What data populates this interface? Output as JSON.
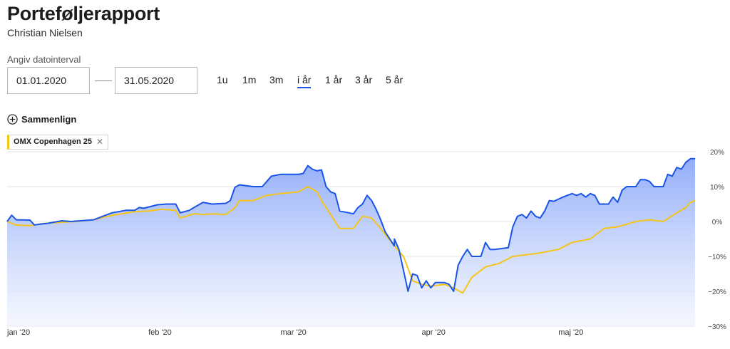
{
  "header": {
    "title": "Porteføljerapport",
    "subtitle": "Christian Nielsen"
  },
  "date_range": {
    "label": "Angiv datointerval",
    "from": "01.01.2020",
    "to": "31.05.2020"
  },
  "periods": [
    "1u",
    "1m",
    "3m",
    "i år",
    "1 år",
    "3 år",
    "5 år"
  ],
  "active_period": "i år",
  "compare": {
    "label": "Sammenlign",
    "chip_label": "OMX Copenhagen 25",
    "chip_color": "#f5c518"
  },
  "colors": {
    "portfolio": "#1a55e8",
    "benchmark": "#f5c518",
    "fill_top": "#7f9ef8",
    "fill_bottom": "#eef2fe"
  },
  "chart_data": {
    "type": "line",
    "title": "",
    "xlabel": "",
    "ylabel": "",
    "x_domain": [
      "2020-01-01",
      "2020-05-31"
    ],
    "x_ticks": [
      {
        "date": "2020-01-01",
        "label": "jan '20"
      },
      {
        "date": "2020-02-01",
        "label": "feb '20"
      },
      {
        "date": "2020-03-01",
        "label": "mar '20"
      },
      {
        "date": "2020-04-01",
        "label": "apr '20"
      },
      {
        "date": "2020-05-01",
        "label": "maj '20"
      }
    ],
    "y_ticks": [
      {
        "value": 20,
        "label": "20%"
      },
      {
        "value": 10,
        "label": "10%"
      },
      {
        "value": 0,
        "label": "0%"
      },
      {
        "value": -10,
        "label": "−10%"
      },
      {
        "value": -20,
        "label": "−20%"
      },
      {
        "value": -30,
        "label": "−30%"
      }
    ],
    "ylim": [
      -30,
      20
    ],
    "grid": true,
    "series": [
      {
        "values": [
          [
            "2020-01-01",
            0
          ],
          [
            "2020-01-02",
            1.8
          ],
          [
            "2020-01-03",
            0.5
          ],
          [
            "2020-01-06",
            0.4
          ],
          [
            "2020-01-07",
            -1.0
          ],
          [
            "2020-01-08",
            -0.8
          ],
          [
            "2020-01-10",
            -0.5
          ],
          [
            "2020-01-13",
            0.2
          ],
          [
            "2020-01-15",
            0
          ],
          [
            "2020-01-17",
            0.2
          ],
          [
            "2020-01-20",
            0.5
          ],
          [
            "2020-01-22",
            1.5
          ],
          [
            "2020-01-24",
            2.5
          ],
          [
            "2020-01-27",
            3.2
          ],
          [
            "2020-01-29",
            3.2
          ],
          [
            "2020-01-30",
            4.0
          ],
          [
            "2020-01-31",
            3.8
          ],
          [
            "2020-02-03",
            4.8
          ],
          [
            "2020-02-05",
            5.0
          ],
          [
            "2020-02-07",
            5.0
          ],
          [
            "2020-02-08",
            2.5
          ],
          [
            "2020-02-10",
            3.2
          ],
          [
            "2020-02-11",
            4.0
          ],
          [
            "2020-02-13",
            5.5
          ],
          [
            "2020-02-15",
            5.0
          ],
          [
            "2020-02-18",
            5.2
          ],
          [
            "2020-02-19",
            6.0
          ],
          [
            "2020-02-20",
            9.8
          ],
          [
            "2020-02-21",
            10.5
          ],
          [
            "2020-02-24",
            10.0
          ],
          [
            "2020-02-26",
            10.0
          ],
          [
            "2020-02-27",
            11.5
          ],
          [
            "2020-02-28",
            13.0
          ],
          [
            "2020-03-01",
            13.5
          ],
          [
            "2020-03-03",
            13.5
          ],
          [
            "2020-03-05",
            13.5
          ],
          [
            "2020-03-06",
            13.8
          ],
          [
            "2020-03-07",
            16.0
          ],
          [
            "2020-03-08",
            15.0
          ],
          [
            "2020-03-09",
            14.5
          ],
          [
            "2020-03-10",
            14.8
          ],
          [
            "2020-03-11",
            10.0
          ],
          [
            "2020-03-12",
            8.5
          ],
          [
            "2020-03-13",
            8.0
          ],
          [
            "2020-03-14",
            3.0
          ],
          [
            "2020-03-16",
            2.5
          ],
          [
            "2020-03-17",
            2.2
          ],
          [
            "2020-03-18",
            4.0
          ],
          [
            "2020-03-19",
            5.0
          ],
          [
            "2020-03-20",
            7.5
          ],
          [
            "2020-03-21",
            6.0
          ],
          [
            "2020-03-22",
            3.5
          ],
          [
            "2020-03-23",
            0.5
          ],
          [
            "2020-03-24",
            -3.0
          ],
          [
            "2020-03-25",
            -5.0
          ],
          [
            "2020-03-26",
            -7.0
          ],
          [
            "2020-03-26",
            -5.0
          ],
          [
            "2020-03-27",
            -8.0
          ],
          [
            "2020-03-29",
            -20.0
          ],
          [
            "2020-03-30",
            -15.0
          ],
          [
            "2020-03-31",
            -15.5
          ],
          [
            "2020-04-01",
            -19.0
          ],
          [
            "2020-04-02",
            -17.0
          ],
          [
            "2020-04-03",
            -19.0
          ],
          [
            "2020-04-04",
            -17.5
          ],
          [
            "2020-04-06",
            -17.5
          ],
          [
            "2020-04-07",
            -18.0
          ],
          [
            "2020-04-08",
            -20.0
          ],
          [
            "2020-04-09",
            -12.5
          ],
          [
            "2020-04-10",
            -10.0
          ],
          [
            "2020-04-11",
            -8.0
          ],
          [
            "2020-04-12",
            -10.0
          ],
          [
            "2020-04-14",
            -10.0
          ],
          [
            "2020-04-15",
            -6.0
          ],
          [
            "2020-04-16",
            -8.0
          ],
          [
            "2020-04-17",
            -8.0
          ],
          [
            "2020-04-20",
            -7.5
          ],
          [
            "2020-04-21",
            -1.5
          ],
          [
            "2020-04-22",
            1.5
          ],
          [
            "2020-04-23",
            2.0
          ],
          [
            "2020-04-24",
            1.0
          ],
          [
            "2020-04-25",
            3.0
          ],
          [
            "2020-04-26",
            1.5
          ],
          [
            "2020-04-27",
            1.0
          ],
          [
            "2020-04-28",
            3.0
          ],
          [
            "2020-04-29",
            6.0
          ],
          [
            "2020-04-30",
            5.8
          ],
          [
            "2020-05-02",
            7.0
          ],
          [
            "2020-05-04",
            8.0
          ],
          [
            "2020-05-05",
            7.5
          ],
          [
            "2020-05-06",
            8.0
          ],
          [
            "2020-05-07",
            7.0
          ],
          [
            "2020-05-08",
            8.0
          ],
          [
            "2020-05-09",
            7.5
          ],
          [
            "2020-05-10",
            5.0
          ],
          [
            "2020-05-12",
            5.0
          ],
          [
            "2020-05-13",
            7.0
          ],
          [
            "2020-05-14",
            5.5
          ],
          [
            "2020-05-15",
            9.0
          ],
          [
            "2020-05-16",
            10.0
          ],
          [
            "2020-05-18",
            10.0
          ],
          [
            "2020-05-19",
            12.0
          ],
          [
            "2020-05-20",
            12.0
          ],
          [
            "2020-05-21",
            11.5
          ],
          [
            "2020-05-22",
            10.0
          ],
          [
            "2020-05-24",
            10.0
          ],
          [
            "2020-05-25",
            13.5
          ],
          [
            "2020-05-26",
            13.0
          ],
          [
            "2020-05-27",
            15.5
          ],
          [
            "2020-05-28",
            15.0
          ],
          [
            "2020-05-29",
            17.0
          ],
          [
            "2020-05-30",
            18.0
          ],
          [
            "2020-05-31",
            18.0
          ]
        ]
      },
      {
        "name": "OMX Copenhagen 25",
        "values": [
          [
            "2020-01-01",
            0
          ],
          [
            "2020-01-03",
            -1.0
          ],
          [
            "2020-01-06",
            -1.2
          ],
          [
            "2020-01-09",
            -0.6
          ],
          [
            "2020-01-13",
            -0.2
          ],
          [
            "2020-01-16",
            0
          ],
          [
            "2020-01-20",
            0.5
          ],
          [
            "2020-01-22",
            1.2
          ],
          [
            "2020-01-25",
            2.0
          ],
          [
            "2020-01-29",
            2.8
          ],
          [
            "2020-02-01",
            3.0
          ],
          [
            "2020-02-04",
            3.5
          ],
          [
            "2020-02-07",
            3.2
          ],
          [
            "2020-02-08",
            1.0
          ],
          [
            "2020-02-11",
            2.2
          ],
          [
            "2020-02-13",
            2.0
          ],
          [
            "2020-02-15",
            2.2
          ],
          [
            "2020-02-18",
            2.0
          ],
          [
            "2020-02-20",
            4.0
          ],
          [
            "2020-02-21",
            6.0
          ],
          [
            "2020-02-24",
            6.0
          ],
          [
            "2020-02-27",
            7.5
          ],
          [
            "2020-03-01",
            8.0
          ],
          [
            "2020-03-05",
            8.5
          ],
          [
            "2020-03-07",
            10.0
          ],
          [
            "2020-03-09",
            8.5
          ],
          [
            "2020-03-10",
            6.0
          ],
          [
            "2020-03-12",
            2.0
          ],
          [
            "2020-03-14",
            -2.0
          ],
          [
            "2020-03-17",
            -2.0
          ],
          [
            "2020-03-19",
            1.5
          ],
          [
            "2020-03-21",
            1.0
          ],
          [
            "2020-03-23",
            -2.0
          ],
          [
            "2020-03-26",
            -7.0
          ],
          [
            "2020-03-28",
            -10.0
          ],
          [
            "2020-03-30",
            -17.0
          ],
          [
            "2020-04-01",
            -18.0
          ],
          [
            "2020-04-03",
            -18.5
          ],
          [
            "2020-04-06",
            -18.0
          ],
          [
            "2020-04-08",
            -19.0
          ],
          [
            "2020-04-10",
            -20.5
          ],
          [
            "2020-04-12",
            -16.0
          ],
          [
            "2020-04-15",
            -13.0
          ],
          [
            "2020-04-18",
            -12.0
          ],
          [
            "2020-04-21",
            -10.0
          ],
          [
            "2020-04-24",
            -9.5
          ],
          [
            "2020-04-27",
            -9.0
          ],
          [
            "2020-05-01",
            -8.0
          ],
          [
            "2020-05-04",
            -6.0
          ],
          [
            "2020-05-08",
            -5.0
          ],
          [
            "2020-05-11",
            -2.0
          ],
          [
            "2020-05-14",
            -1.5
          ],
          [
            "2020-05-18",
            0.0
          ],
          [
            "2020-05-21",
            0.5
          ],
          [
            "2020-05-24",
            0.0
          ],
          [
            "2020-05-27",
            2.5
          ],
          [
            "2020-05-29",
            4.0
          ],
          [
            "2020-05-30",
            5.5
          ],
          [
            "2020-05-31",
            6.0
          ]
        ]
      }
    ]
  }
}
